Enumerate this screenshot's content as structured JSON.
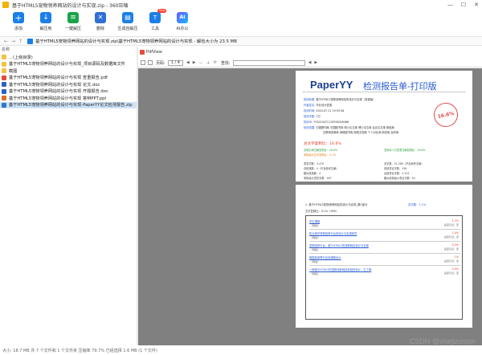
{
  "window": {
    "title": "基于HTML5宠物领养网站的设计与实现.zip - 360压缩",
    "controls": [
      "—",
      "☐",
      "✕"
    ]
  },
  "toolbar": {
    "buttons": [
      {
        "label": "添加",
        "icon": "add-icon"
      },
      {
        "label": "解压到",
        "icon": "extract-icon"
      },
      {
        "label": "一键解压",
        "icon": "one-click-extract-icon"
      },
      {
        "label": "删除",
        "icon": "delete-icon"
      },
      {
        "label": "生成自解压",
        "icon": "self-extract-icon"
      },
      {
        "label": "工具",
        "icon": "tools-icon",
        "badge": "New"
      },
      {
        "label": "AI办公",
        "icon": "ai-icon"
      }
    ]
  },
  "pathbar": {
    "path": "基于HTML5宠物领养网站的设计与实现.zip\\基于HTML5宠物领养网站的设计与实现 - 解包大小为 23.5 MB"
  },
  "file_list": {
    "header": "名称",
    "items": [
      {
        "name": ".. (上级目录)",
        "type": "folder"
      },
      {
        "name": "基于HTML5宠物领养网站的设计与实现_项目源码及数据库文件",
        "type": "folder"
      },
      {
        "name": "截图",
        "type": "folder"
      },
      {
        "name": "基于HTML5宠物领养网站的设计与实现 查重报告.pdf",
        "type": "pdf"
      },
      {
        "name": "基于HTML5宠物领养网站的设计与实现 论文.doc",
        "type": "doc"
      },
      {
        "name": "基于HTML5宠物领养网站的设计与实现 开题报告.doc",
        "type": "doc"
      },
      {
        "name": "基于HTML5宠物领养网站的设计与实现 答辩PPT.ppt",
        "type": "ppt"
      },
      {
        "name": "基于HTML5宠物领养网站的设计与实现-PaperYY论文检测报告.zip",
        "type": "zip",
        "selected": true
      }
    ]
  },
  "viewer": {
    "tab": "PdfView",
    "page_label": "页码:",
    "page_value": "1 / 4",
    "find_label": "查找:"
  },
  "report": {
    "brand": "PaperYY",
    "title": "检测报告单-打印版",
    "stamp": "16.6%",
    "meta": [
      {
        "k": "检测标题:",
        "v": "基于HTML5宠物领养网站的设计与实现（查重版）"
      },
      {
        "k": "作者姓名:",
        "v": "毕业设计查重"
      },
      {
        "k": "检测时间:",
        "v": "2024-07-11 19:55:46"
      },
      {
        "k": "检测字数:",
        "v": "1万"
      },
      {
        "k": "检测ID:",
        "v": "YY2024071119556426466"
      },
      {
        "k": "检测范围:",
        "v": "中国期刊库 中国图书库 硕士论文库 博士论文库 会议论文库 报纸库"
      },
      {
        "k": "",
        "v": "互联网资源库 网络图书库 网络文档库 个人对比库 网页库 百科库"
      }
    ],
    "similarity_head": "总文字复制比：16.6%",
    "sim_lines": [
      {
        "left": "去除引用文献复制比：16.6%",
        "right": "去除本人已发表文献复制比：16.6%"
      },
      {
        "left": "单篇最大文字复制比：4.7%",
        "right": ""
      }
    ],
    "stats": [
      {
        "left": "重复字数：3,470",
        "right": "总字数：21,289（不含参考文献）"
      },
      {
        "left": "总段落数：4（不含参考文献）",
        "right": "前部重合字数：299"
      },
      {
        "left": "疑似段落数：4",
        "right": "后部重合字数：3,224"
      },
      {
        "left": "单篇最大重复字数：997",
        "right": "疑似段落最小重合字数：81"
      }
    ],
    "page2": {
      "head": "1. 基于HTML5宠物领养网站的设计与实现_第1部分",
      "rate": "总字数：1.1%",
      "sub": "文字复制比：9.1%（999）",
      "items": [
        {
          "title": "学生课程",
          "author": "-《网络》-",
          "pct": "1.2%",
          "src": "是否引证：否"
        },
        {
          "title": "牧业城市宠物领养平台的设计与实现研究",
          "author": "-《网络》-",
          "pct": "1.0%",
          "src": "是否引证：否"
        },
        {
          "title": "宠物领养平台、基于HTML5的宠物网站设计与实现",
          "author": "-《网络》-",
          "pct": "0.5%",
          "src": "是否引证：否"
        },
        {
          "title": "数据库原理与应用课程设计",
          "author": "-《网络》-",
          "pct": "1%",
          "src": "是否引证：否"
        },
        {
          "title": "一种基于HTML5的宠物领养网站系统的设计 - 王丁明",
          "author": "-《网络》-",
          "pct": "0.9%",
          "src": "是否引证：否"
        }
      ]
    }
  },
  "status": {
    "text": "大小: 18.7 MB 共 7 个文件和 1 个文件夹 压缩率 79.7% 已经选择 1.6 MB (1 个文件)"
  },
  "watermark": "CSDN @shejizuopin"
}
